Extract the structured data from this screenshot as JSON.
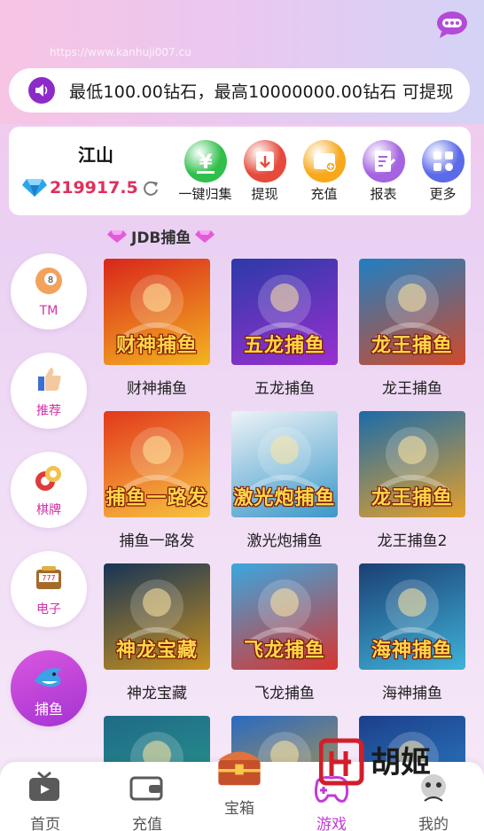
{
  "watermark": "https://www.kanhuji007.cu",
  "marquee": {
    "text": "最低100.00钻石，最高10000000.00钻石 可提现"
  },
  "account": {
    "username": "江山",
    "balance": "219917.5"
  },
  "actions": [
    {
      "label": "一键归集",
      "icon": "yen-icon",
      "color": "#2fbf4a"
    },
    {
      "label": "提现",
      "icon": "withdraw-icon",
      "color": "#e64a3b"
    },
    {
      "label": "充值",
      "icon": "wallet-icon",
      "color": "#f7a81b"
    },
    {
      "label": "报表",
      "icon": "report-icon",
      "color": "#a463e0"
    },
    {
      "label": "更多",
      "icon": "more-icon",
      "color": "#5b6ae8"
    }
  ],
  "section_title": "JDB捕鱼",
  "categories": [
    {
      "label": "TM",
      "icon": "billiard-ball-icon"
    },
    {
      "label": "推荐",
      "icon": "thumbs-up-icon"
    },
    {
      "label": "棋牌",
      "icon": "poker-chips-icon"
    },
    {
      "label": "电子",
      "icon": "slot-machine-icon"
    },
    {
      "label": "捕鱼",
      "icon": "shark-icon"
    }
  ],
  "games": [
    {
      "name": "财神捕鱼",
      "art": "财神捕鱼",
      "bg1": "#d9261c",
      "bg2": "#f4b41f"
    },
    {
      "name": "五龙捕鱼",
      "art": "五龙捕鱼",
      "bg1": "#2b3aa8",
      "bg2": "#9b2fd0"
    },
    {
      "name": "龙王捕鱼",
      "art": "龙王捕鱼",
      "bg1": "#1f7fc2",
      "bg2": "#d04a2a"
    },
    {
      "name": "捕鱼一路发",
      "art": "捕鱼一路发",
      "bg1": "#e2391c",
      "bg2": "#f7c440"
    },
    {
      "name": "激光炮捕鱼",
      "art": "激光炮捕鱼",
      "bg1": "#eef3f7",
      "bg2": "#3a98c9"
    },
    {
      "name": "龙王捕鱼2",
      "art": "龙王捕鱼",
      "bg1": "#1c6ba9",
      "bg2": "#e6a12a"
    },
    {
      "name": "神龙宝藏",
      "art": "神龙宝藏",
      "bg1": "#173456",
      "bg2": "#c9921f"
    },
    {
      "name": "飞龙捕鱼",
      "art": "飞龙捕鱼",
      "bg1": "#3aa7e0",
      "bg2": "#d9342e"
    },
    {
      "name": "海神捕鱼",
      "art": "海神捕鱼",
      "bg1": "#1b3f74",
      "bg2": "#3fb3d9"
    },
    {
      "name": "",
      "art": "",
      "bg1": "#1f6a88",
      "bg2": "#2a9d8a"
    },
    {
      "name": "",
      "art": "",
      "bg1": "#2a6ac2",
      "bg2": "#d4a02a"
    },
    {
      "name": "",
      "art": "",
      "bg1": "#1c3f8a",
      "bg2": "#2f8ad0"
    }
  ],
  "tabs": [
    {
      "label": "首页",
      "icon": "tv-icon",
      "active": false
    },
    {
      "label": "充值",
      "icon": "wallet-icon",
      "active": false
    },
    {
      "label": "宝箱",
      "icon": "treasure-chest-icon",
      "active": false
    },
    {
      "label": "游戏",
      "icon": "gamepad-icon",
      "active": true
    },
    {
      "label": "我的",
      "icon": "profile-icon",
      "active": false
    }
  ],
  "logo_text": "胡姬"
}
